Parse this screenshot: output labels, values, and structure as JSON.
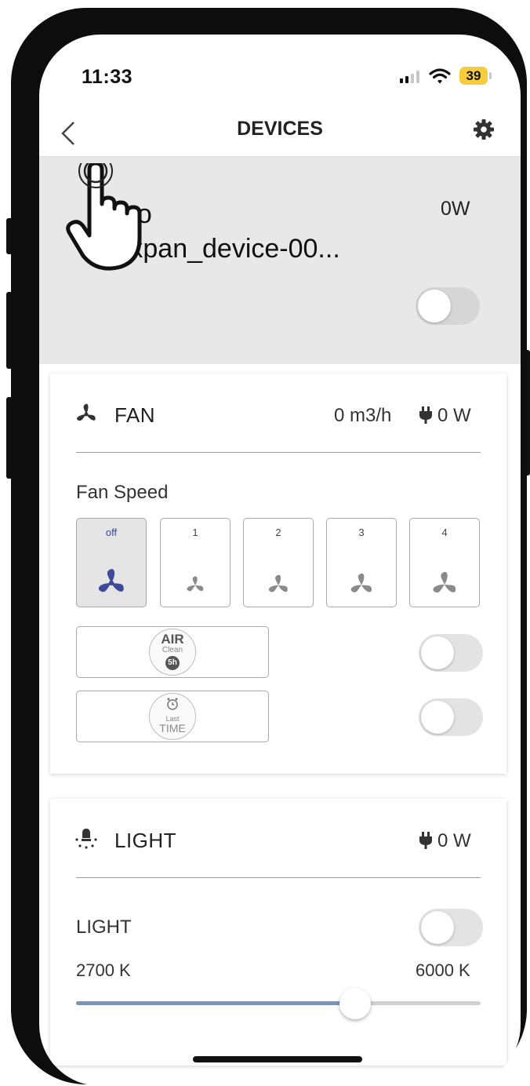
{
  "status_bar": {
    "time": "11:33",
    "battery": "39"
  },
  "nav": {
    "title": "DEVICES"
  },
  "device": {
    "brand": "Lkpo",
    "name": "inoxpan_device-00...",
    "power": "0W",
    "enabled": false
  },
  "fan": {
    "title": "FAN",
    "airflow": "0 m3/h",
    "power": "0 W",
    "speed_label": "Fan Speed",
    "speeds": [
      {
        "label": "off",
        "selected": true
      },
      {
        "label": "1",
        "selected": false
      },
      {
        "label": "2",
        "selected": false
      },
      {
        "label": "3",
        "selected": false
      },
      {
        "label": "4",
        "selected": false
      }
    ],
    "modes": [
      {
        "badge_top": "AIR",
        "badge_mid": "Clean",
        "badge_bottom": "5h",
        "enabled": false
      },
      {
        "badge_top": "Last",
        "badge_bottom": "TIME",
        "enabled": false
      }
    ]
  },
  "light": {
    "title": "LIGHT",
    "power": "0 W",
    "toggle_label": "LIGHT",
    "enabled": false,
    "temp_min": "2700 K",
    "temp_max": "6000 K",
    "temp_position": 0.69
  },
  "colors": {
    "accent": "#3d4a99",
    "slider_fill": "#7e93b8",
    "battery": "#f6cc3b",
    "panel": "#e8e8e8"
  }
}
